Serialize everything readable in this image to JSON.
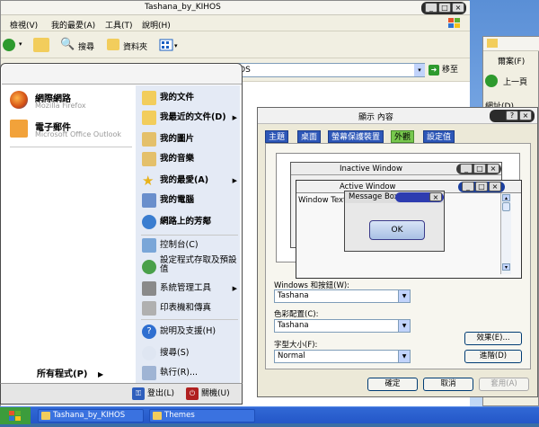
{
  "explorer": {
    "title": "Tashana_by_KIHOS",
    "menu": [
      "檢視(V)",
      "我的最愛(A)",
      "工具(T)",
      "說明(H)"
    ],
    "toolbar": {
      "search": "搜尋",
      "folders": "資料夾"
    },
    "address_value": "OS",
    "go_label": "移至"
  },
  "right_window": {
    "menu_favorites": "爾案(F)",
    "back_label": "上一頁",
    "address_label": "網址(D)"
  },
  "start_menu": {
    "pinned": [
      {
        "name": "網際網路",
        "sub": "Mozilla Firefox",
        "icon": "firefox-icon"
      },
      {
        "name": "電子郵件",
        "sub": "Microsoft Office Outlook",
        "icon": "outlook-icon"
      }
    ],
    "all_programs": "所有程式(P)",
    "right_items": [
      {
        "label": "我的文件",
        "icon": "documents-icon"
      },
      {
        "label": "我最近的文件(D)",
        "icon": "recent-documents-icon"
      },
      {
        "label": "我的圖片",
        "icon": "pictures-icon"
      },
      {
        "label": "我的音樂",
        "icon": "music-icon"
      },
      {
        "label": "我的最愛(A)",
        "icon": "favorites-star-icon"
      },
      {
        "label": "我的電腦",
        "icon": "computer-icon"
      },
      {
        "label": "網路上的芳鄰",
        "icon": "network-icon"
      }
    ],
    "right_items2": [
      {
        "label": "控制台(C)",
        "icon": "control-panel-icon"
      },
      {
        "label": "設定程式存取及預設值",
        "icon": "program-access-icon"
      },
      {
        "label": "系統管理工具",
        "icon": "admin-tools-icon"
      },
      {
        "label": "印表機和傳真",
        "icon": "printer-icon"
      }
    ],
    "right_items3": [
      {
        "label": "說明及支援(H)",
        "icon": "help-icon"
      },
      {
        "label": "搜尋(S)",
        "icon": "search-icon"
      },
      {
        "label": "執行(R)...",
        "icon": "run-icon"
      }
    ],
    "logoff": "登出(L)",
    "shutdown": "關機(U)"
  },
  "dialog": {
    "title": "顯示 內容",
    "tabs": [
      "主題",
      "桌面",
      "螢幕保護裝置",
      "外觀",
      "設定值"
    ],
    "active_tab": "外觀",
    "preview": {
      "inactive": "Inactive Window",
      "active": "Active Window",
      "window_text": "Window Text",
      "message": "Message Box",
      "ok": "OK"
    },
    "windows_buttons_label": "Windows 和按鈕(W):",
    "windows_buttons_value": "Tashana",
    "color_scheme_label": "色彩配置(C):",
    "color_scheme_value": "Tashana",
    "font_size_label": "字型大小(F):",
    "font_size_value": "Normal",
    "effects_button": "效果(E)...",
    "advanced_button": "進階(D)",
    "ok_button": "確定",
    "cancel_button": "取消",
    "apply_button": "套用(A)"
  },
  "taskbar": {
    "tasks": [
      "Tashana_by_KIHOS",
      "Themes"
    ]
  },
  "colors": {
    "tab_blue": "#2d57b8",
    "tab_active_green": "#77c84d",
    "title_pill_dark": "#333333"
  }
}
